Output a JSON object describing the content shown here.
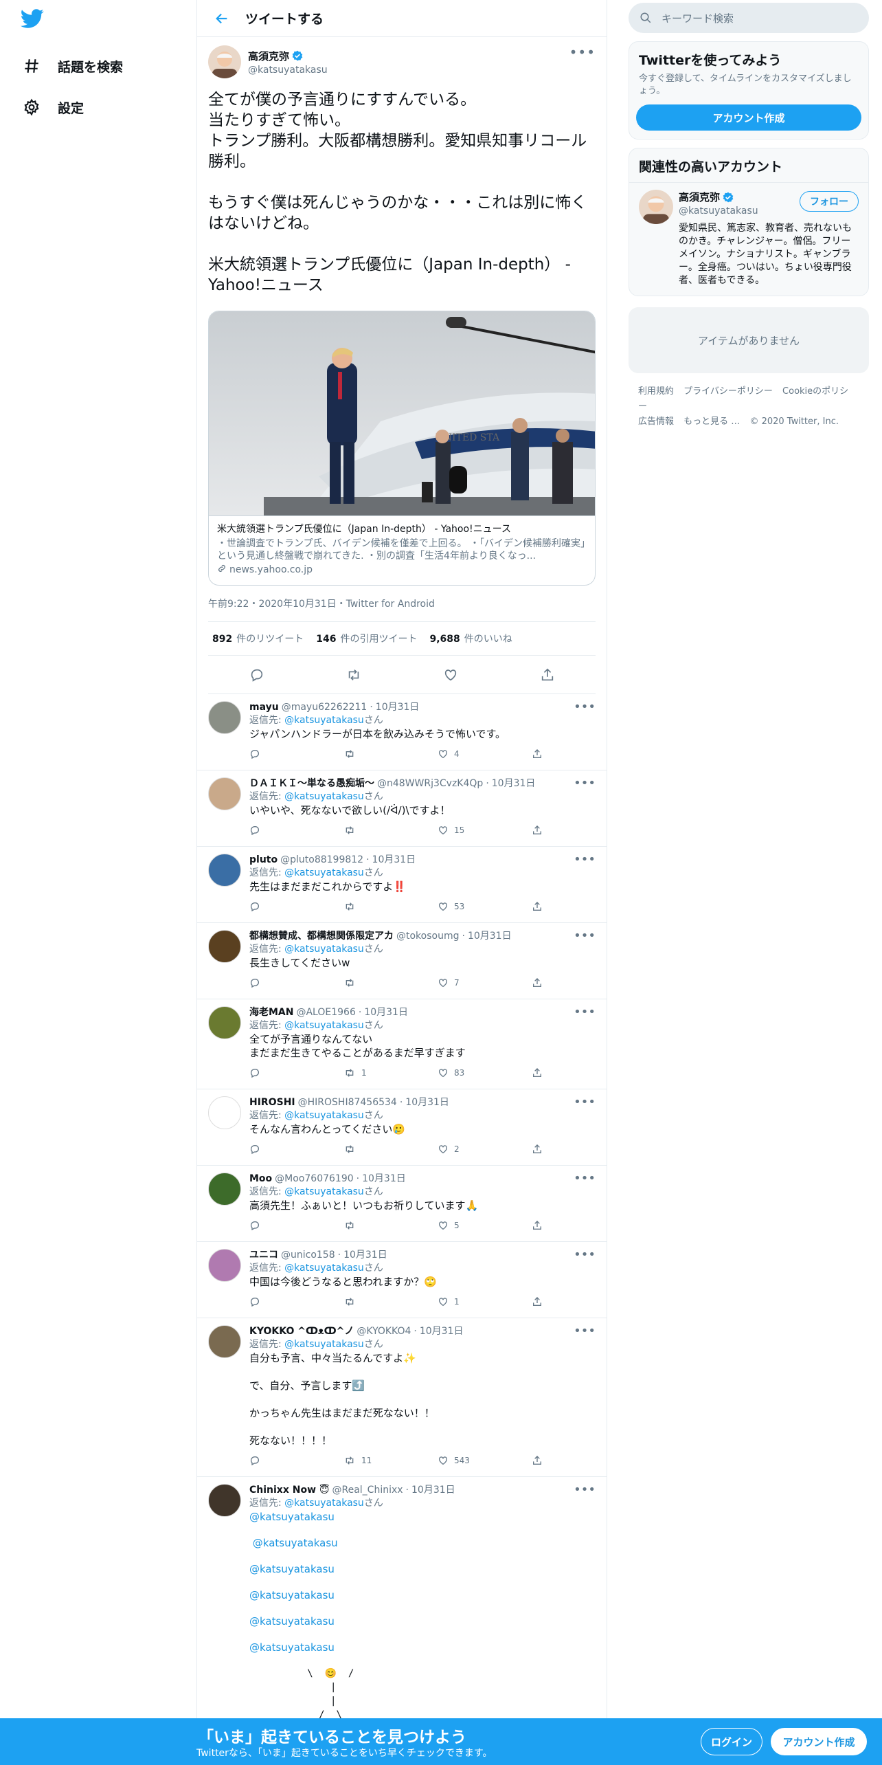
{
  "nav": {
    "logo": "twitter-bird-icon",
    "items": [
      {
        "label": "話題を検索",
        "icon": "hashtag-icon"
      },
      {
        "label": "設定",
        "icon": "gear-icon"
      }
    ]
  },
  "header": {
    "title": "ツイートする"
  },
  "tweet": {
    "name": "高須克弥",
    "handle": "@katsuyatakasu",
    "text": "全てが僕の予言通りにすすんでいる。\n当たりすぎて怖い。\nトランプ勝利。大阪都構想勝利。愛知県知事リコール勝利。\n\nもうすぐ僕は死んじゃうのかな・・・これは別に怖くはないけどね。\n\n米大統領選トランプ氏優位に（Japan In-depth） - Yahoo!ニュース",
    "card": {
      "title": "米大統領選トランプ氏優位に（Japan In-depth） - Yahoo!ニュース",
      "desc": "・世論調査でトランプ氏、バイデン候補を僅差で上回る。 ・「バイデン候補勝利確実」という見通し終盤戦で崩れてきた. ・別の調査「生活4年前より良くなっ...",
      "url": "news.yahoo.co.jp"
    },
    "meta": "午前9:22・2020年10月31日・Twitter for Android",
    "retweets": "892",
    "retweets_label": "件のリツイート",
    "quotes": "146",
    "quotes_label": "件の引用ツイート",
    "likes": "9,688",
    "likes_label": "件のいいね"
  },
  "replies": [
    {
      "name": "mayu",
      "handle": "@mayu62262211",
      "date": "10月31日",
      "reply_prefix": "返信先: ",
      "to": "@katsuyatakasu",
      "reply_suffix": "さん",
      "text": "ジャパンハンドラーが日本を飲み込みそうで怖いです。",
      "rt": "",
      "likes": "4",
      "avatar_color": "#8a8f86"
    },
    {
      "name": "ＤＡＩＫＩ〜単なる愚痴垢〜",
      "handle": "@n48WWRj3CvzK4Qp",
      "date": "10月31日",
      "reply_prefix": "返信先: ",
      "to": "@katsuyatakasu",
      "reply_suffix": "さん",
      "text": "いやいや、死なないで欲しい(/ᐛ/)\\ですよ！",
      "rt": "",
      "likes": "15",
      "avatar_color": "#c9a98a"
    },
    {
      "name": "pluto",
      "handle": "@pluto88199812",
      "date": "10月31日",
      "reply_prefix": "返信先: ",
      "to": "@katsuyatakasu",
      "reply_suffix": "さん",
      "text": "先生はまだまだこれからですよ‼️",
      "rt": "",
      "likes": "53",
      "avatar_color": "#3a6ea5"
    },
    {
      "name": "都構想賛成、都構想関係限定アカ",
      "handle": "@tokosoumg",
      "date": "10月31日",
      "reply_prefix": "返信先: ",
      "to": "@katsuyatakasu",
      "reply_suffix": "さん",
      "text": "長生きしてくださいw",
      "rt": "",
      "likes": "7",
      "avatar_color": "#5a4020"
    },
    {
      "name": "海老MAN",
      "handle": "@ALOE1966",
      "date": "10月31日",
      "reply_prefix": "返信先: ",
      "to": "@katsuyatakasu",
      "reply_suffix": "さん",
      "text": "全てが予言通りなんてない\nまだまだ生きてやることがあるまだ早すぎます",
      "rt": "1",
      "likes": "83",
      "avatar_color": "#6a7a30"
    },
    {
      "name": "HIROSHI",
      "handle": "@HIROSHI87456534",
      "date": "10月31日",
      "reply_prefix": "返信先: ",
      "to": "@katsuyatakasu",
      "reply_suffix": "さん",
      "text": "そんなん言わんとってください🥲",
      "rt": "",
      "likes": "2",
      "avatar_color": "#ffffff"
    },
    {
      "name": "Moo",
      "handle": "@Moo76076190",
      "date": "10月31日",
      "reply_prefix": "返信先: ",
      "to": "@katsuyatakasu",
      "reply_suffix": "さん",
      "text": "高須先生！ふぁいと！いつもお祈りしています🙏",
      "rt": "",
      "likes": "5",
      "avatar_color": "#3d6b2a"
    },
    {
      "name": "ユニコ",
      "handle": "@unico158",
      "date": "10月31日",
      "reply_prefix": "返信先: ",
      "to": "@katsuyatakasu",
      "reply_suffix": "さん",
      "text": "中国は今後どうなると思われますか？🙄",
      "rt": "",
      "likes": "1",
      "avatar_color": "#b07ab0"
    },
    {
      "name": "KYOKKO ^ↀᴥↀ^ノ",
      "handle": "@KYOKKO4",
      "date": "10月31日",
      "reply_prefix": "返信先: ",
      "to": "@katsuyatakasu",
      "reply_suffix": "さん",
      "text": "自分も予言、中々当たるんですよ✨\n\nで、自分、予言します⤴️\n\nかっちゃん先生はまだまだ死なない！！\n\n死なない！！！！",
      "rt": "11",
      "likes": "543",
      "avatar_color": "#7a6a50"
    },
    {
      "name": "Chinixx Now 😇",
      "handle": "@Real_Chinixx",
      "date": "10月31日",
      "reply_prefix": "返信先: ",
      "to": "@katsuyatakasu",
      "reply_suffix": "さん",
      "mentions": [
        "@katsuyatakasu",
        " @katsuyatakasu",
        "@katsuyatakasu",
        "@katsuyatakasu",
        "@katsuyatakasu",
        "@katsuyatakasu"
      ],
      "art": "          \\  😊  /\n              |\n              |\n            /  \\",
      "avatar_color": "#40352a"
    }
  ],
  "right": {
    "search_placeholder": "キーワード検索",
    "signup_title": "Twitterを使ってみよう",
    "signup_sub": "今すぐ登録して、タイムラインをカスタマイズしましょう。",
    "signup_button": "アカウント作成",
    "related_title": "関連性の高いアカウント",
    "related": {
      "name": "高須克弥",
      "handle": "@katsuyatakasu",
      "follow": "フォロー",
      "bio": "愛知県民、篤志家、教育者、売れないものかき。チャレンジャー。僧侶。フリーメイソン。ナショナリスト。ギャンブラー。全身癌。ついはい。ちょい役専門役者、医者もできる。"
    },
    "empty": "アイテムがありません",
    "footer": [
      "利用規約",
      "プライバシーポリシー",
      "Cookieのポリシー",
      "広告情報",
      "もっと見る …",
      "© 2020 Twitter, Inc."
    ]
  },
  "bottom": {
    "title": "「いま」起きていることを見つけよう",
    "sub": "Twitterなら、「いま」起きていることをいち早くチェックできます。",
    "login": "ログイン",
    "signup": "アカウント作成"
  },
  "colors": {
    "accent": "#1da1f2",
    "link": "#1b95e0",
    "muted": "#657786",
    "border": "#e6ecf0"
  }
}
